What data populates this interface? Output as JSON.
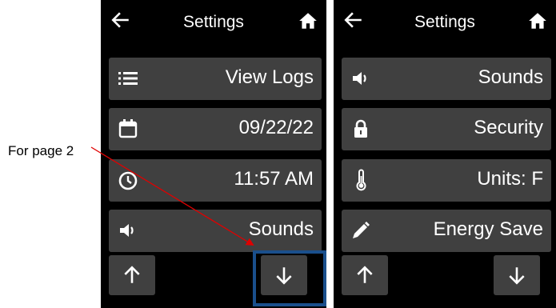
{
  "annotation": {
    "text": "For page 2"
  },
  "screens": [
    {
      "header": {
        "title": "Settings",
        "back_icon": "arrow-left-icon",
        "home_icon": "home-icon"
      },
      "items": [
        {
          "icon": "list-icon",
          "label": "View Logs"
        },
        {
          "icon": "calendar-icon",
          "label": "09/22/22"
        },
        {
          "icon": "clock-icon",
          "label": "11:57 AM"
        },
        {
          "icon": "speaker-icon",
          "label": "Sounds"
        }
      ],
      "nav": {
        "up_icon": "arrow-up-icon",
        "down_icon": "arrow-down-icon"
      }
    },
    {
      "header": {
        "title": "Settings",
        "back_icon": "arrow-left-icon",
        "home_icon": "home-icon"
      },
      "items": [
        {
          "icon": "speaker-icon",
          "label": "Sounds"
        },
        {
          "icon": "lock-icon",
          "label": "Security"
        },
        {
          "icon": "thermometer-icon",
          "label": "Units: F"
        },
        {
          "icon": "pencil-icon",
          "label": "Energy Save"
        }
      ],
      "nav": {
        "up_icon": "arrow-up-icon",
        "down_icon": "arrow-down-icon"
      }
    }
  ],
  "colors": {
    "screen_bg": "#000000",
    "button_bg": "#404040",
    "highlight": "#1a4f8c",
    "annotation_arrow": "#e00000"
  }
}
